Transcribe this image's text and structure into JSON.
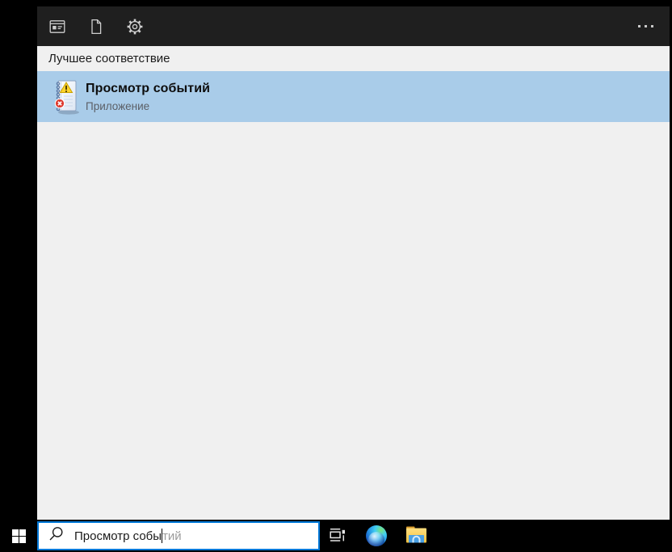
{
  "panel": {
    "header": {
      "filter_tabs": [
        {
          "id": "apps",
          "icon": "apps-filter-icon"
        },
        {
          "id": "documents",
          "icon": "document-filter-icon"
        },
        {
          "id": "settings",
          "icon": "settings-gear-icon"
        }
      ],
      "more": {
        "icon": "more-ellipsis-icon"
      }
    },
    "section_title": "Лучшее соответствие",
    "best_match": {
      "title": "Просмотр событий",
      "subtitle": "Приложение",
      "icon": "event-viewer-icon"
    }
  },
  "taskbar": {
    "start": {
      "icon": "windows-logo-icon"
    },
    "search": {
      "icon": "search-icon",
      "typed": "Просмотр собы",
      "suggestion": "тий"
    },
    "buttons": [
      {
        "id": "task-view",
        "icon": "task-view-icon"
      },
      {
        "id": "edge",
        "icon": "edge-browser-icon"
      },
      {
        "id": "file-explorer",
        "icon": "file-explorer-icon"
      }
    ]
  },
  "colors": {
    "accent_blue": "#0078d7",
    "result_highlight": "#a9cce9",
    "panel_background": "#f0f0f0",
    "panel_header_background": "#1f1f1f",
    "taskbar_background": "#000000"
  }
}
